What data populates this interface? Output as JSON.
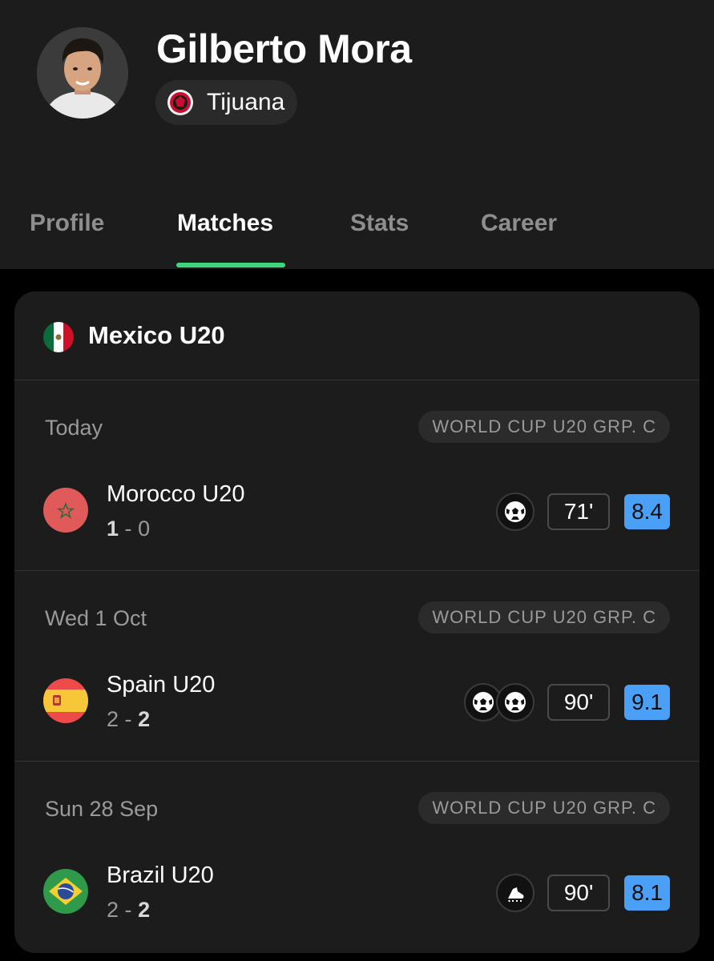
{
  "player": {
    "name": "Gilberto Mora",
    "club": "Tijuana"
  },
  "tabs": [
    {
      "label": "Profile"
    },
    {
      "label": "Matches"
    },
    {
      "label": "Stats"
    },
    {
      "label": "Career"
    }
  ],
  "active_tab": "Matches",
  "card": {
    "team": "Mexico U20"
  },
  "matches": [
    {
      "date": "Today",
      "competition": "WORLD CUP U20 GRP. C",
      "opponent": "Morocco U20",
      "score_home": "1",
      "score_away": "0",
      "score_sep": "-",
      "events": [
        "soccer-ball-icon"
      ],
      "minutes": "71'",
      "rating": "8.4",
      "rating_color": "#4a9ff7"
    },
    {
      "date": "Wed 1 Oct",
      "competition": "WORLD CUP U20 GRP. C",
      "opponent": "Spain U20",
      "score_home": "2",
      "score_away": "2",
      "score_sep": "-",
      "events": [
        "soccer-ball-icon",
        "soccer-ball-icon"
      ],
      "minutes": "90'",
      "rating": "9.1",
      "rating_color": "#4a9ff7"
    },
    {
      "date": "Sun 28 Sep",
      "competition": "WORLD CUP U20 GRP. C",
      "opponent": "Brazil U20",
      "score_home": "2",
      "score_away": "2",
      "score_sep": "-",
      "events": [
        "football-boot-icon"
      ],
      "minutes": "90'",
      "rating": "8.1",
      "rating_color": "#4a9ff7"
    }
  ],
  "colors": {
    "accent": "#3fd67a",
    "background": "#1c1c1c",
    "muted_text": "#9a9a9a"
  }
}
